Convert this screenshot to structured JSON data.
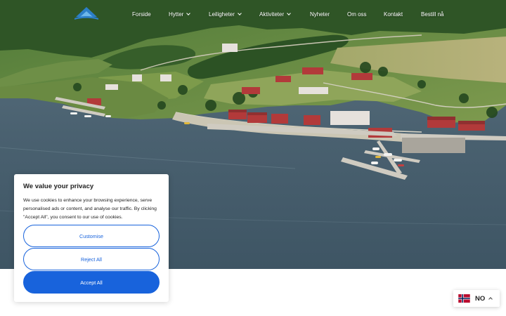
{
  "brand": {
    "logo_icon": "cabin-roof-logo",
    "accent": "#1863dc"
  },
  "nav": {
    "items": [
      {
        "label": "Forside",
        "has_dropdown": false
      },
      {
        "label": "Hytter",
        "has_dropdown": true
      },
      {
        "label": "Leiligheter",
        "has_dropdown": true
      },
      {
        "label": "Aktiviteter",
        "has_dropdown": true
      },
      {
        "label": "Nyheter",
        "has_dropdown": false
      },
      {
        "label": "Om oss",
        "has_dropdown": false
      },
      {
        "label": "Kontakt",
        "has_dropdown": false
      },
      {
        "label": "Bestill nå",
        "has_dropdown": false
      }
    ]
  },
  "cookie": {
    "title": "We value your privacy",
    "body": "We use cookies to enhance your browsing experience, serve personalised ads or content, and analyse our traffic. By clicking \"Accept All\", you consent to our use of cookies.",
    "customise_label": "Customise",
    "reject_label": "Reject All",
    "accept_label": "Accept All"
  },
  "language": {
    "code": "NO",
    "flag_icon": "norway-flag-icon"
  }
}
